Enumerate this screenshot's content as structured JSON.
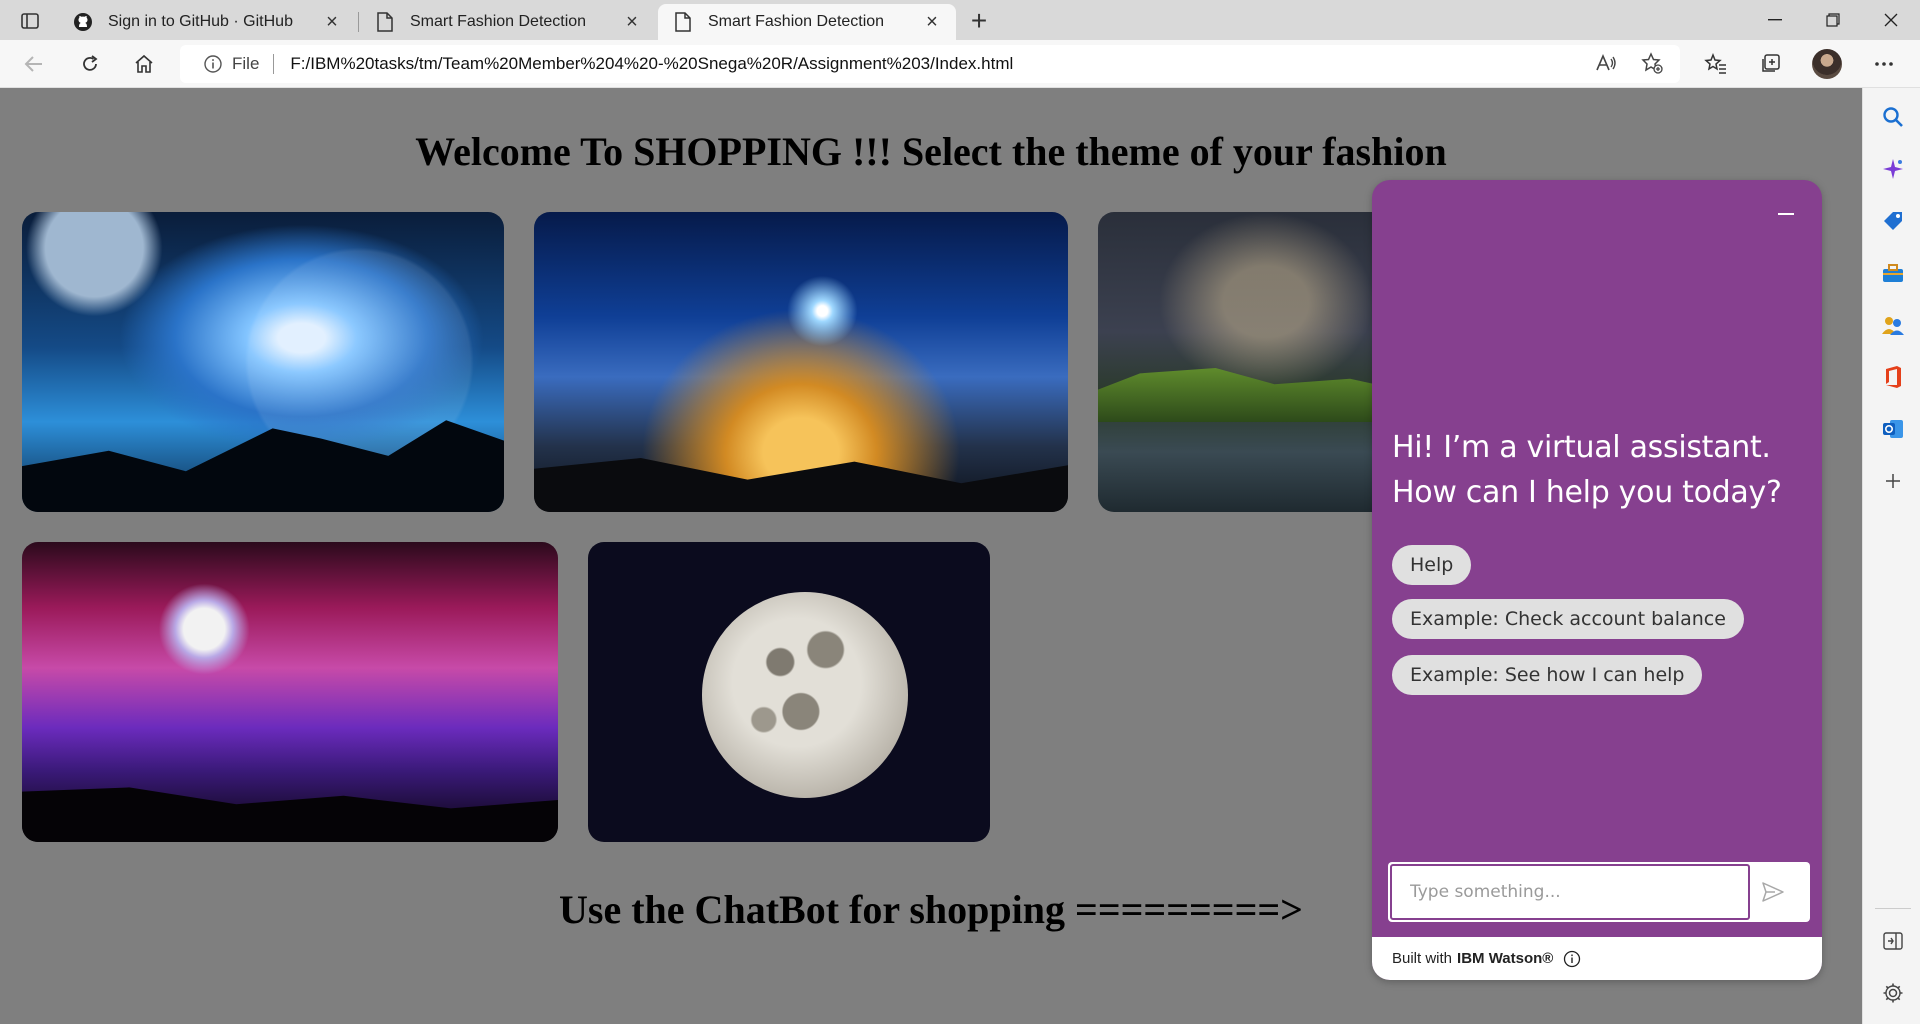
{
  "browser": {
    "tabs": [
      {
        "title": "Sign in to GitHub · GitHub",
        "favicon": "github-icon",
        "active": false
      },
      {
        "title": "Smart Fashion Detection",
        "favicon": "page-icon",
        "active": false
      },
      {
        "title": "Smart Fashion Detection",
        "favicon": "page-icon",
        "active": true
      }
    ],
    "address": {
      "scheme_label": "File",
      "url": "F:/IBM%20tasks/tm/Team%20Member%204%20-%20Snega%20R/Assignment%203/Index.html"
    },
    "sidebar_icons": [
      "search-icon",
      "sparkle-icon",
      "shopping-tag-icon",
      "toolbox-icon",
      "people-icon",
      "office-icon",
      "outlook-icon",
      "plus-icon",
      "panel-toggle-icon",
      "settings-icon"
    ]
  },
  "page": {
    "heading": "Welcome To SHOPPING !!! Select the theme of your fashion",
    "themes": [
      {
        "name": "wolf-moon-theme"
      },
      {
        "name": "night-city-theme"
      },
      {
        "name": "milky-way-lake-theme"
      },
      {
        "name": "purple-tree-theme"
      },
      {
        "name": "full-moon-theme"
      }
    ],
    "footer": "Use the ChatBot for shopping =========>"
  },
  "chat": {
    "greeting": "Hi! I’m a virtual assistant. How can I help you today?",
    "quick_replies": [
      "Help",
      "Example: Check account balance",
      "Example: See how I can help"
    ],
    "input_placeholder": "Type something...",
    "footer_prefix": "Built with",
    "footer_brand": "IBM Watson®",
    "accent": "#86408f"
  }
}
